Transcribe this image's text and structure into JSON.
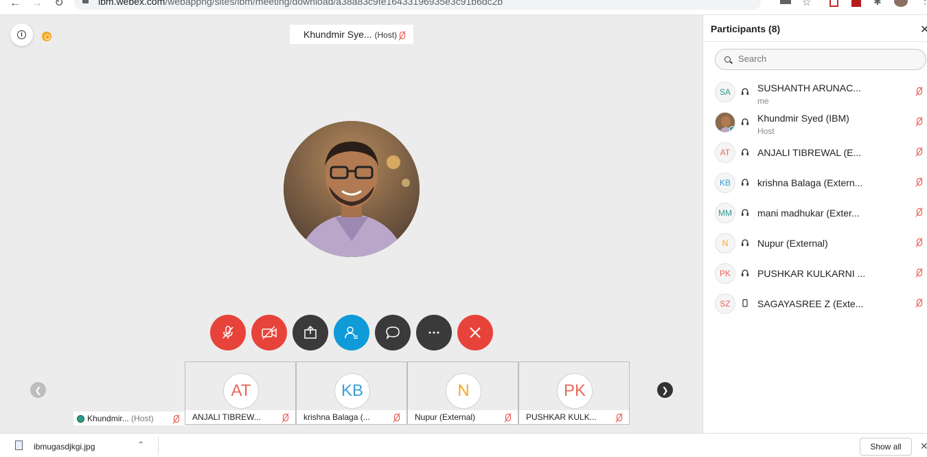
{
  "browser": {
    "url_host": "ibm.webex.com",
    "url_path": "/webappng/sites/ibm/meeting/download/a38a83c9fe16433196935e3c91b6dc2b"
  },
  "meeting": {
    "active_speaker": {
      "name": "Khundmir Sye...",
      "role": "(Host)"
    },
    "controls": [
      {
        "name": "mute-button",
        "icon": "mic-off-icon"
      },
      {
        "name": "stop-video-button",
        "icon": "video-off-icon"
      },
      {
        "name": "share-button",
        "icon": "share-icon"
      },
      {
        "name": "participants-button",
        "icon": "participants-icon"
      },
      {
        "name": "chat-button",
        "icon": "chat-icon"
      },
      {
        "name": "more-button",
        "icon": "more-icon"
      },
      {
        "name": "leave-button",
        "icon": "close-icon"
      }
    ],
    "host_tile": {
      "name": "Khundmir...",
      "role": "(Host)"
    },
    "tiles": [
      {
        "initials": "AT",
        "label": "ANJALI TIBREW...",
        "color": "#e8675a"
      },
      {
        "initials": "KB",
        "label": "krishna Balaga (...",
        "color": "#3a9fd1"
      },
      {
        "initials": "N",
        "label": "Nupur (External)",
        "color": "#f5a623"
      },
      {
        "initials": "PK",
        "label": "PUSHKAR KULK...",
        "color": "#e8675a"
      }
    ]
  },
  "panel": {
    "title": "Participants (8)",
    "search_placeholder": "Search",
    "participants": [
      {
        "initials": "SA",
        "name": "SUSHANTH ARUNAC...",
        "sub": "me",
        "color": "#2a9d8f",
        "audio": "headset"
      },
      {
        "initials": "",
        "name": "Khundmir Syed (IBM)",
        "sub": "Host",
        "color": "#7a6a5c",
        "audio": "headset"
      },
      {
        "initials": "AT",
        "name": "ANJALI TIBREWAL (E...",
        "sub": "",
        "color": "#e8675a",
        "audio": "headset"
      },
      {
        "initials": "KB",
        "name": "krishna Balaga (Extern...",
        "sub": "",
        "color": "#3a9fd1",
        "audio": "headset"
      },
      {
        "initials": "MM",
        "name": "mani madhukar (Exter...",
        "sub": "",
        "color": "#2a9d8f",
        "audio": "headset"
      },
      {
        "initials": "N",
        "name": "Nupur (External)",
        "sub": "",
        "color": "#f5a623",
        "audio": "headset"
      },
      {
        "initials": "PK",
        "name": "PUSHKAR KULKARNI ...",
        "sub": "",
        "color": "#e8675a",
        "audio": "headset"
      },
      {
        "initials": "SZ",
        "name": "SAGAYASREE Z (Exte...",
        "sub": "",
        "color": "#e8675a",
        "audio": "phone"
      }
    ]
  },
  "downloads": {
    "file_name": "ibmugasdjkgi.jpg",
    "show_all_label": "Show all"
  }
}
